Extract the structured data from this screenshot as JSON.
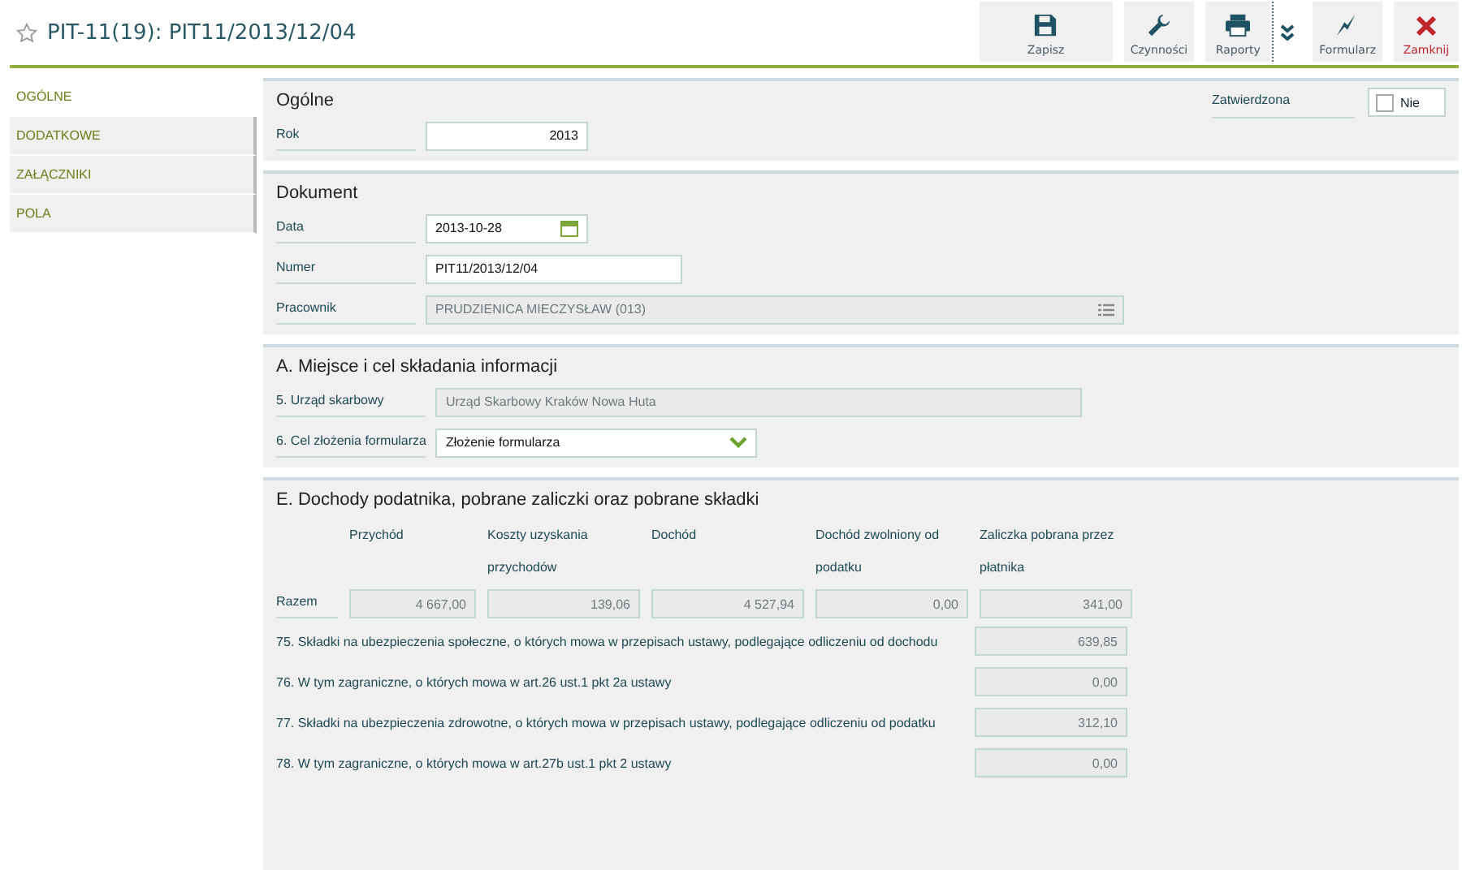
{
  "header": {
    "title": "PIT-11(19): PIT11/2013/12/04",
    "favorite": false
  },
  "toolbar": [
    {
      "kind": "save",
      "label": "Zapisz"
    },
    {
      "kind": "actions",
      "label": "Czynności"
    },
    {
      "kind": "reports",
      "label": "Raporty"
    },
    {
      "kind": "more"
    },
    {
      "kind": "form",
      "label": "Formularz"
    },
    {
      "kind": "close",
      "label": "Zamknij"
    }
  ],
  "sidebar": {
    "items": [
      {
        "label": "OGÓLNE",
        "selected": true
      },
      {
        "label": "DODATKOWE",
        "selected": false
      },
      {
        "label": "ZAŁĄCZNIKI",
        "selected": false
      },
      {
        "label": "POLA",
        "selected": false
      }
    ]
  },
  "sections": [
    {
      "kind": "form",
      "title": "Ogólne",
      "aside": {
        "label": "Zatwierdzona",
        "checked": false,
        "text": "Nie"
      },
      "rows": [
        {
          "label": "Rok",
          "field": {
            "kind": "number",
            "value": "2013"
          }
        }
      ]
    },
    {
      "kind": "form",
      "title": "Dokument",
      "rows": [
        {
          "label": "Data",
          "field": {
            "kind": "date",
            "value": "2013-10-28"
          }
        },
        {
          "label": "Numer",
          "field": {
            "kind": "text",
            "value": "PIT11/2013/12/04"
          }
        },
        {
          "label": "Pracownik",
          "field": {
            "kind": "lookup",
            "value": "PRUDZIENICA MIECZYSŁAW (013)"
          }
        }
      ]
    },
    {
      "kind": "form",
      "title": "A. Miejsce i cel składania informacji",
      "rows": [
        {
          "label": "5. Urząd skarbowy",
          "field": {
            "kind": "readonly",
            "value": "Urząd Skarbowy Kraków Nowa Huta"
          }
        },
        {
          "label": "6. Cel złożenia formularza",
          "field": {
            "kind": "select",
            "value": "Złożenie formularza"
          }
        }
      ]
    },
    {
      "kind": "income",
      "title": "E. Dochody podatnika, pobrane zaliczki oraz pobrane składki",
      "columns": [
        "Przychód",
        "Koszty uzyskania przychodów",
        "Dochód",
        "Dochód zwolniony od podatku",
        "Zaliczka pobrana przez płatnika"
      ],
      "total": {
        "label": "Razem",
        "values": [
          "4 667,00",
          "139,06",
          "4 527,94",
          "0,00",
          "341,00"
        ]
      },
      "items": [
        {
          "label": "75. Składki na ubezpieczenia społeczne, o których mowa w przepisach ustawy, podlegające odliczeniu od dochodu",
          "value": "639,85"
        },
        {
          "label": "76. W tym zagraniczne, o których mowa w art.26 ust.1 pkt 2a ustawy",
          "value": "0,00"
        },
        {
          "label": "77. Składki na ubezpieczenia zdrowotne, o których mowa w przepisach ustawy, podlegające odliczeniu od podatku",
          "value": "312,10"
        },
        {
          "label": "78. W tym zagraniczne, o których mowa w art.27b ust.1 pkt 2 ustawy",
          "value": "0,00"
        }
      ]
    }
  ]
}
